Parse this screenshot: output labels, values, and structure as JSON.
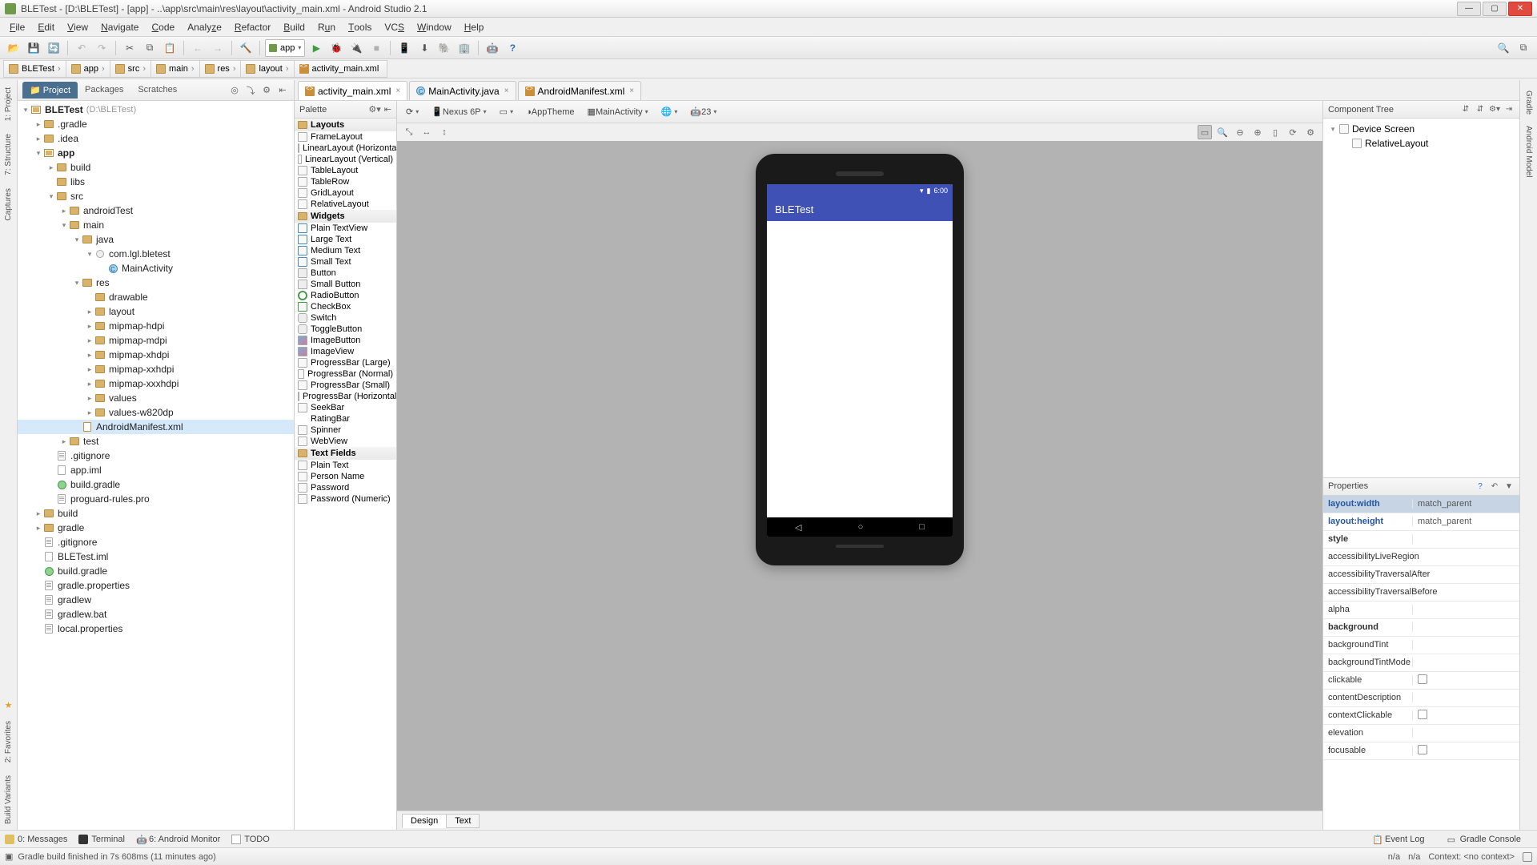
{
  "window": {
    "title": "BLETest - [D:\\BLETest] - [app] - ..\\app\\src\\main\\res\\layout\\activity_main.xml - Android Studio 2.1"
  },
  "menu": {
    "items": [
      "File",
      "Edit",
      "View",
      "Navigate",
      "Code",
      "Analyze",
      "Refactor",
      "Build",
      "Run",
      "Tools",
      "VCS",
      "Window",
      "Help"
    ]
  },
  "breadcrumb": {
    "items": [
      {
        "icon": "folder",
        "label": "BLETest"
      },
      {
        "icon": "folder",
        "label": "app"
      },
      {
        "icon": "folder",
        "label": "src"
      },
      {
        "icon": "folder",
        "label": "main"
      },
      {
        "icon": "folder",
        "label": "res"
      },
      {
        "icon": "folder",
        "label": "layout"
      },
      {
        "icon": "xml",
        "label": "activity_main.xml"
      }
    ]
  },
  "run_config": {
    "label": "app"
  },
  "project_panel": {
    "tabs": {
      "project": "Project",
      "packages": "Packages",
      "scratches": "Scratches"
    },
    "root": {
      "label": "BLETest",
      "hint": "(D:\\BLETest)"
    }
  },
  "tree": {
    "gradle_dir": ".gradle",
    "idea_dir": ".idea",
    "app_dir": "app",
    "build_dir": "build",
    "libs_dir": "libs",
    "src_dir": "src",
    "androidTest": "androidTest",
    "main_dir": "main",
    "java_dir": "java",
    "pkg": "com.lgl.bletest",
    "mainActivity": "MainActivity",
    "res_dir": "res",
    "drawable": "drawable",
    "layout_dir": "layout",
    "mipmap_hdpi": "mipmap-hdpi",
    "mipmap_mdpi": "mipmap-mdpi",
    "mipmap_xhdpi": "mipmap-xhdpi",
    "mipmap_xxhdpi": "mipmap-xxhdpi",
    "mipmap_xxxhdpi": "mipmap-xxxhdpi",
    "values": "values",
    "values_w820": "values-w820dp",
    "manifest": "AndroidManifest.xml",
    "test_dir": "test",
    "gitignore": ".gitignore",
    "app_iml": "app.iml",
    "build_gradle": "build.gradle",
    "proguard": "proguard-rules.pro",
    "outer_build": "build",
    "outer_gradle": "gradle",
    "outer_gitignore": ".gitignore",
    "ble_iml": "BLETest.iml",
    "outer_build_gradle": "build.gradle",
    "gradle_properties": "gradle.properties",
    "gradlew": "gradlew",
    "gradlew_bat": "gradlew.bat",
    "local_properties": "local.properties"
  },
  "editor_tabs": {
    "t1": "activity_main.xml",
    "t2": "MainActivity.java",
    "t3": "AndroidManifest.xml"
  },
  "palette": {
    "title": "Palette",
    "cats": {
      "layouts": "Layouts",
      "widgets": "Widgets",
      "textfields": "Text Fields"
    },
    "layouts": [
      "FrameLayout",
      "LinearLayout (Horizontal)",
      "LinearLayout (Vertical)",
      "TableLayout",
      "TableRow",
      "GridLayout",
      "RelativeLayout"
    ],
    "widgets": [
      "Plain TextView",
      "Large Text",
      "Medium Text",
      "Small Text",
      "Button",
      "Small Button",
      "RadioButton",
      "CheckBox",
      "Switch",
      "ToggleButton",
      "ImageButton",
      "ImageView",
      "ProgressBar (Large)",
      "ProgressBar (Normal)",
      "ProgressBar (Small)",
      "ProgressBar (Horizontal)",
      "SeekBar",
      "RatingBar",
      "Spinner",
      "WebView"
    ],
    "textfields": [
      "Plain Text",
      "Person Name",
      "Password",
      "Password (Numeric)"
    ]
  },
  "design_toolbar": {
    "device": "Nexus 6P",
    "theme": "AppTheme",
    "activity": "MainActivity",
    "api": "23"
  },
  "preview": {
    "clock": "6:00",
    "app_title": "BLETest"
  },
  "design_mode_tabs": {
    "design": "Design",
    "text": "Text"
  },
  "component_tree": {
    "title": "Component Tree",
    "device_screen": "Device Screen",
    "relative_layout": "RelativeLayout"
  },
  "properties": {
    "title": "Properties",
    "rows": [
      {
        "name": "layout:width",
        "val": "match_parent",
        "link": true,
        "sel": true
      },
      {
        "name": "layout:height",
        "val": "match_parent",
        "link": true
      },
      {
        "name": "style",
        "val": "",
        "bold": true
      },
      {
        "name": "accessibilityLiveRegion",
        "val": ""
      },
      {
        "name": "accessibilityTraversalAfter",
        "val": ""
      },
      {
        "name": "accessibilityTraversalBefore",
        "val": ""
      },
      {
        "name": "alpha",
        "val": ""
      },
      {
        "name": "background",
        "val": "",
        "bold": true
      },
      {
        "name": "backgroundTint",
        "val": ""
      },
      {
        "name": "backgroundTintMode",
        "val": ""
      },
      {
        "name": "clickable",
        "val": "",
        "check": true
      },
      {
        "name": "contentDescription",
        "val": ""
      },
      {
        "name": "contextClickable",
        "val": "",
        "check": true
      },
      {
        "name": "elevation",
        "val": ""
      },
      {
        "name": "focusable",
        "val": "",
        "check": true
      }
    ]
  },
  "left_gutter": {
    "project": "1: Project",
    "structure": "7: Structure",
    "captures": "Captures",
    "favorites": "2: Favorites",
    "build_variants": "Build Variants"
  },
  "right_gutter": {
    "gradle": "Gradle",
    "android_model": "Android Model"
  },
  "bottom_tools": {
    "messages": "0: Messages",
    "terminal": "Terminal",
    "monitor": "6: Android Monitor",
    "todo": "TODO",
    "event_log": "Event Log",
    "gradle_console": "Gradle Console"
  },
  "status": {
    "msg": "Gradle build finished in 7s 608ms (11 minutes ago)",
    "right": {
      "na1": "n/a",
      "na2": "n/a",
      "context": "Context: <no context>"
    }
  }
}
